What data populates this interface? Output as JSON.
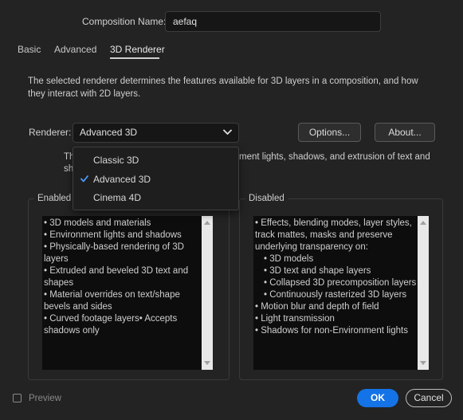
{
  "composition": {
    "label": "Composition Name:",
    "value": "aefaq"
  },
  "tabs": [
    {
      "label": "Basic"
    },
    {
      "label": "Advanced"
    },
    {
      "label": "3D Renderer",
      "active": true
    }
  ],
  "description": "The selected renderer determines the features available for 3D layers in a composition, and how they interact with 2D layers.",
  "renderer": {
    "label": "Renderer:",
    "selected": "Advanced 3D",
    "options_button": "Options...",
    "about_button": "About..."
  },
  "partial_text": {
    "line1_left": "Th",
    "line1_right": "ment lights, shadows, and extrusion of text and",
    "line2_left": "sh"
  },
  "dropdown": {
    "items": [
      {
        "label": "Classic 3D",
        "checked": false
      },
      {
        "label": "Advanced 3D",
        "checked": true
      },
      {
        "label": "Cinema 4D",
        "checked": false
      }
    ]
  },
  "enabled": {
    "title": "Enabled",
    "lines": [
      "• 3D models and materials",
      "• Environment lights and shadows",
      "• Physically-based rendering of 3D",
      "layers",
      "• Extruded and beveled 3D text and",
      "shapes",
      "• Material overrides on text/shape",
      "bevels and sides",
      "• Curved footage layers• Accepts",
      "shadows only"
    ]
  },
  "disabled": {
    "title": "Disabled",
    "lines": [
      "• Effects, blending modes, layer styles,",
      "track mattes, masks and preserve",
      "underlying transparency on:",
      "• 3D models",
      "• 3D text and shape layers",
      "• Collapsed 3D precomposition layers",
      "• Continuously rasterized 3D layers",
      "• Motion blur and depth of field",
      "• Light transmission",
      "• Shadows for non-Environment lights"
    ]
  },
  "footer": {
    "preview_label": "Preview",
    "ok_label": "OK",
    "cancel_label": "Cancel"
  },
  "colors": {
    "background": "#232323",
    "accent": "#1473e6"
  }
}
